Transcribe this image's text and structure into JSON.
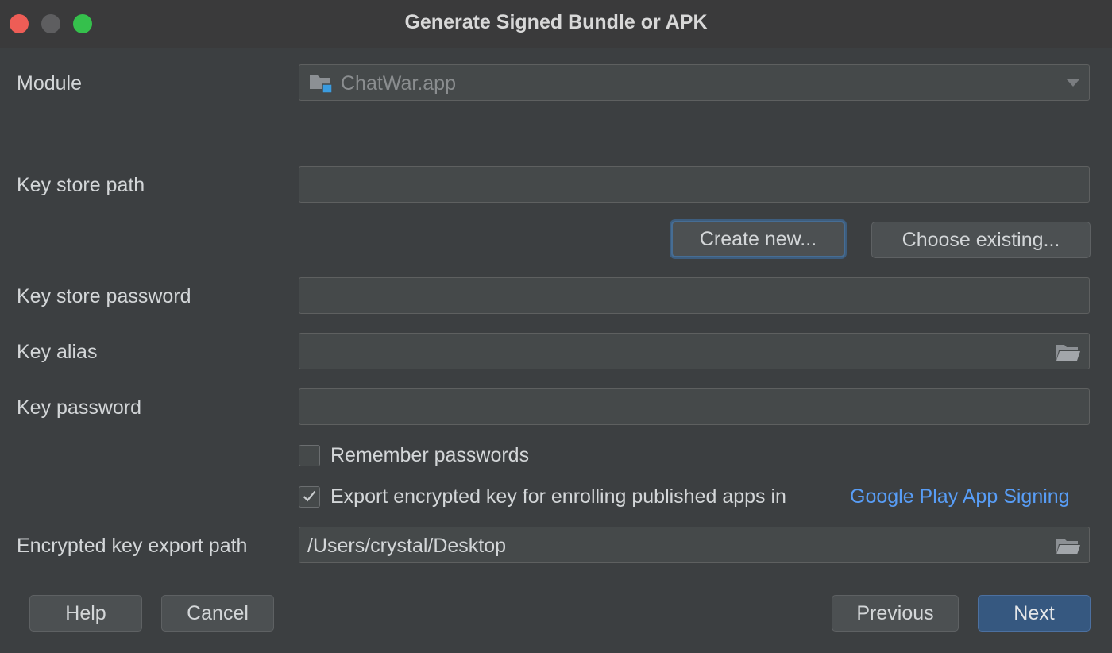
{
  "window": {
    "title": "Generate Signed Bundle or APK"
  },
  "form": {
    "module_label": "Module",
    "module_value": "ChatWar.app",
    "keystore_path_label": "Key store path",
    "keystore_path_value": "",
    "create_new_label": "Create new...",
    "choose_existing_label": "Choose existing...",
    "keystore_password_label": "Key store password",
    "keystore_password_value": "",
    "key_alias_label": "Key alias",
    "key_alias_value": "",
    "key_password_label": "Key password",
    "key_password_value": "",
    "remember_passwords_label": "Remember passwords",
    "remember_passwords_checked": false,
    "export_key_label": "Export encrypted key for enrolling published apps in",
    "export_key_link": "Google Play App Signing",
    "export_key_checked": true,
    "export_path_label": "Encrypted key export path",
    "export_path_value": "/Users/crystal/Desktop"
  },
  "buttons": {
    "help": "Help",
    "cancel": "Cancel",
    "previous": "Previous",
    "next": "Next"
  },
  "colors": {
    "background": "#3c3f41",
    "field": "#45494a",
    "link": "#589df6",
    "primary_button": "#365880"
  },
  "icons": {
    "module": "module-folder-icon",
    "browse": "folder-open-icon",
    "check": "checkmark-icon"
  }
}
